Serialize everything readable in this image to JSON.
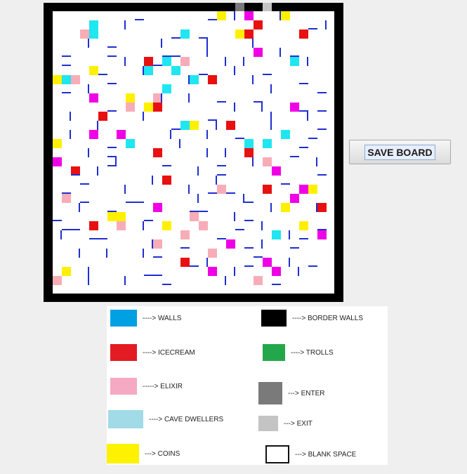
{
  "board": {
    "grid_size": 31,
    "colors": {
      "border": "#000000",
      "wall": "#1f2fd0",
      "icecream": "#e81010",
      "elixir": "#f7adb7",
      "cave_dwellers": "#1fe6f0",
      "coins": "#fff000",
      "magenta": "#f000e6",
      "enter": "#7a7a7a",
      "exit": "#c4c4c4"
    },
    "gates": [
      {
        "type": "enter",
        "col": 20
      },
      {
        "type": "exit",
        "col": 23
      }
    ],
    "cells": [
      {
        "t": "coins",
        "c": 18,
        "r": 0
      },
      {
        "t": "magenta",
        "c": 21,
        "r": 0
      },
      {
        "t": "coins",
        "c": 25,
        "r": 0
      },
      {
        "t": "cave_dwellers",
        "c": 4,
        "r": 1
      },
      {
        "t": "icecream",
        "c": 22,
        "r": 1
      },
      {
        "t": "elixir",
        "c": 3,
        "r": 2
      },
      {
        "t": "cave_dwellers",
        "c": 4,
        "r": 2
      },
      {
        "t": "cave_dwellers",
        "c": 14,
        "r": 2
      },
      {
        "t": "coins",
        "c": 20,
        "r": 2
      },
      {
        "t": "icecream",
        "c": 21,
        "r": 2
      },
      {
        "t": "icecream",
        "c": 27,
        "r": 2
      },
      {
        "t": "magenta",
        "c": 22,
        "r": 4
      },
      {
        "t": "icecream",
        "c": 10,
        "r": 5
      },
      {
        "t": "cave_dwellers",
        "c": 12,
        "r": 5
      },
      {
        "t": "elixir",
        "c": 14,
        "r": 5
      },
      {
        "t": "cave_dwellers",
        "c": 26,
        "r": 5
      },
      {
        "t": "coins",
        "c": 4,
        "r": 6
      },
      {
        "t": "cave_dwellers",
        "c": 10,
        "r": 6
      },
      {
        "t": "cave_dwellers",
        "c": 13,
        "r": 6
      },
      {
        "t": "coins",
        "c": 0,
        "r": 7
      },
      {
        "t": "cave_dwellers",
        "c": 1,
        "r": 7
      },
      {
        "t": "elixir",
        "c": 2,
        "r": 7
      },
      {
        "t": "cave_dwellers",
        "c": 15,
        "r": 7
      },
      {
        "t": "icecream",
        "c": 17,
        "r": 7
      },
      {
        "t": "cave_dwellers",
        "c": 12,
        "r": 8
      },
      {
        "t": "magenta",
        "c": 4,
        "r": 9
      },
      {
        "t": "coins",
        "c": 8,
        "r": 9
      },
      {
        "t": "elixir",
        "c": 11,
        "r": 9
      },
      {
        "t": "elixir",
        "c": 8,
        "r": 10
      },
      {
        "t": "coins",
        "c": 10,
        "r": 10
      },
      {
        "t": "icecream",
        "c": 11,
        "r": 10
      },
      {
        "t": "magenta",
        "c": 26,
        "r": 10
      },
      {
        "t": "icecream",
        "c": 5,
        "r": 11
      },
      {
        "t": "cave_dwellers",
        "c": 14,
        "r": 12
      },
      {
        "t": "coins",
        "c": 15,
        "r": 12
      },
      {
        "t": "icecream",
        "c": 19,
        "r": 12
      },
      {
        "t": "magenta",
        "c": 4,
        "r": 13
      },
      {
        "t": "magenta",
        "c": 7,
        "r": 13
      },
      {
        "t": "cave_dwellers",
        "c": 25,
        "r": 13
      },
      {
        "t": "coins",
        "c": 0,
        "r": 14
      },
      {
        "t": "cave_dwellers",
        "c": 8,
        "r": 14
      },
      {
        "t": "cave_dwellers",
        "c": 21,
        "r": 14
      },
      {
        "t": "cave_dwellers",
        "c": 23,
        "r": 14
      },
      {
        "t": "icecream",
        "c": 11,
        "r": 15
      },
      {
        "t": "icecream",
        "c": 21,
        "r": 15
      },
      {
        "t": "magenta",
        "c": 0,
        "r": 16
      },
      {
        "t": "elixir",
        "c": 23,
        "r": 16
      },
      {
        "t": "icecream",
        "c": 2,
        "r": 17
      },
      {
        "t": "magenta",
        "c": 24,
        "r": 17
      },
      {
        "t": "icecream",
        "c": 12,
        "r": 18
      },
      {
        "t": "elixir",
        "c": 18,
        "r": 19
      },
      {
        "t": "icecream",
        "c": 23,
        "r": 19
      },
      {
        "t": "magenta",
        "c": 27,
        "r": 19
      },
      {
        "t": "coins",
        "c": 28,
        "r": 19
      },
      {
        "t": "elixir",
        "c": 1,
        "r": 20
      },
      {
        "t": "magenta",
        "c": 26,
        "r": 20
      },
      {
        "t": "magenta",
        "c": 11,
        "r": 21
      },
      {
        "t": "coins",
        "c": 25,
        "r": 21
      },
      {
        "t": "icecream",
        "c": 29,
        "r": 21
      },
      {
        "t": "coins",
        "c": 6,
        "r": 22
      },
      {
        "t": "coins",
        "c": 7,
        "r": 22
      },
      {
        "t": "elixir",
        "c": 15,
        "r": 22
      },
      {
        "t": "icecream",
        "c": 4,
        "r": 23
      },
      {
        "t": "elixir",
        "c": 7,
        "r": 23
      },
      {
        "t": "coins",
        "c": 12,
        "r": 23
      },
      {
        "t": "elixir",
        "c": 16,
        "r": 23
      },
      {
        "t": "coins",
        "c": 27,
        "r": 23
      },
      {
        "t": "elixir",
        "c": 14,
        "r": 24
      },
      {
        "t": "cave_dwellers",
        "c": 24,
        "r": 24
      },
      {
        "t": "magenta",
        "c": 29,
        "r": 24
      },
      {
        "t": "elixir",
        "c": 11,
        "r": 25
      },
      {
        "t": "magenta",
        "c": 19,
        "r": 25
      },
      {
        "t": "elixir",
        "c": 17,
        "r": 26
      },
      {
        "t": "icecream",
        "c": 14,
        "r": 27
      },
      {
        "t": "magenta",
        "c": 23,
        "r": 27
      },
      {
        "t": "coins",
        "c": 1,
        "r": 28
      },
      {
        "t": "magenta",
        "c": 17,
        "r": 28
      },
      {
        "t": "magenta",
        "c": 24,
        "r": 28
      },
      {
        "t": "elixir",
        "c": 0,
        "r": 29
      },
      {
        "t": "elixir",
        "c": 22,
        "r": 29
      }
    ],
    "walls": [
      {
        "o": "h",
        "c": 9,
        "r": 0
      },
      {
        "o": "h",
        "c": 17,
        "r": 0
      },
      {
        "o": "v",
        "c": 19,
        "r": 0
      },
      {
        "o": "v",
        "c": 24,
        "r": 0
      },
      {
        "o": "v",
        "c": 7,
        "r": 1
      },
      {
        "o": "h",
        "c": 13,
        "r": 2
      },
      {
        "o": "h",
        "c": 16,
        "r": 2
      },
      {
        "o": "v",
        "c": 29,
        "r": 1
      },
      {
        "o": "h",
        "c": 28,
        "r": 1
      },
      {
        "o": "v",
        "c": 3,
        "r": 3
      },
      {
        "o": "h",
        "c": 6,
        "r": 3
      },
      {
        "o": "v",
        "c": 11,
        "r": 3
      },
      {
        "o": "v",
        "c": 16,
        "r": 3
      },
      {
        "o": "v",
        "c": 21,
        "r": 3
      },
      {
        "o": "h",
        "c": 1,
        "r": 4
      },
      {
        "o": "h",
        "c": 6,
        "r": 4
      },
      {
        "o": "h",
        "c": 12,
        "r": 4
      },
      {
        "o": "h",
        "c": 13,
        "r": 4
      },
      {
        "o": "v",
        "c": 16,
        "r": 4
      },
      {
        "o": "v",
        "c": 24,
        "r": 4
      },
      {
        "o": "h",
        "c": 26,
        "r": 4
      },
      {
        "o": "h",
        "c": 1,
        "r": 5
      },
      {
        "o": "v",
        "c": 7,
        "r": 5
      },
      {
        "o": "h",
        "c": 11,
        "r": 5
      },
      {
        "o": "v",
        "c": 18,
        "r": 5
      },
      {
        "o": "v",
        "c": 20,
        "r": 5
      },
      {
        "o": "v",
        "c": 27,
        "r": 5
      },
      {
        "o": "h",
        "c": 5,
        "r": 6
      },
      {
        "o": "v",
        "c": 9,
        "r": 6
      },
      {
        "o": "h",
        "c": 16,
        "r": 6
      },
      {
        "o": "v",
        "c": 19,
        "r": 6
      },
      {
        "o": "h",
        "c": 23,
        "r": 6
      },
      {
        "o": "h",
        "c": 6,
        "r": 7
      },
      {
        "o": "v",
        "c": 14,
        "r": 7
      },
      {
        "o": "v",
        "c": 21,
        "r": 7
      },
      {
        "o": "h",
        "c": 27,
        "r": 7
      },
      {
        "o": "h",
        "c": 1,
        "r": 8
      },
      {
        "o": "v",
        "c": 3,
        "r": 8
      },
      {
        "o": "v",
        "c": 23,
        "r": 8
      },
      {
        "o": "h",
        "c": 29,
        "r": 8
      },
      {
        "o": "v",
        "c": 11,
        "r": 9
      },
      {
        "o": "v",
        "c": 14,
        "r": 9
      },
      {
        "o": "h",
        "c": 18,
        "r": 9
      },
      {
        "o": "h",
        "c": 22,
        "r": 9
      },
      {
        "o": "h",
        "c": 6,
        "r": 10
      },
      {
        "o": "v",
        "c": 19,
        "r": 10
      },
      {
        "o": "v",
        "c": 22,
        "r": 10
      },
      {
        "o": "h",
        "c": 27,
        "r": 10
      },
      {
        "o": "h",
        "c": 29,
        "r": 10
      },
      {
        "o": "v",
        "c": 1,
        "r": 11
      },
      {
        "o": "v",
        "c": 9,
        "r": 11
      },
      {
        "o": "h",
        "c": 17,
        "r": 11
      },
      {
        "o": "v",
        "c": 23,
        "r": 11
      },
      {
        "o": "v",
        "c": 27,
        "r": 11
      },
      {
        "o": "v",
        "c": 4,
        "r": 12
      },
      {
        "o": "h",
        "c": 13,
        "r": 12
      },
      {
        "o": "v",
        "c": 17,
        "r": 12
      },
      {
        "o": "v",
        "c": 23,
        "r": 12
      },
      {
        "o": "h",
        "c": 29,
        "r": 12
      },
      {
        "o": "h",
        "c": 20,
        "r": 13
      },
      {
        "o": "v",
        "c": 1,
        "r": 13
      },
      {
        "o": "v",
        "c": 12,
        "r": 13
      },
      {
        "o": "v",
        "c": 16,
        "r": 13
      },
      {
        "o": "h",
        "c": 28,
        "r": 13
      },
      {
        "o": "h",
        "c": 6,
        "r": 14
      },
      {
        "o": "v",
        "c": 13,
        "r": 14
      },
      {
        "o": "h",
        "c": 27,
        "r": 14
      },
      {
        "o": "v",
        "c": 3,
        "r": 15
      },
      {
        "o": "h",
        "c": 6,
        "r": 15
      },
      {
        "o": "v",
        "c": 16,
        "r": 15
      },
      {
        "o": "v",
        "c": 18,
        "r": 15
      },
      {
        "o": "h",
        "c": 26,
        "r": 15
      },
      {
        "o": "v",
        "c": 6,
        "r": 16
      },
      {
        "o": "h",
        "c": 6,
        "r": 16
      },
      {
        "o": "h",
        "c": 12,
        "r": 16
      },
      {
        "o": "h",
        "c": 18,
        "r": 16
      },
      {
        "o": "v",
        "c": 21,
        "r": 16
      },
      {
        "o": "v",
        "c": 28,
        "r": 16
      },
      {
        "o": "h",
        "c": 2,
        "r": 17
      },
      {
        "o": "v",
        "c": 4,
        "r": 17
      },
      {
        "o": "v",
        "c": 15,
        "r": 17
      },
      {
        "o": "h",
        "c": 18,
        "r": 17
      },
      {
        "o": "h",
        "c": 29,
        "r": 17
      },
      {
        "o": "h",
        "c": 3,
        "r": 18
      },
      {
        "o": "v",
        "c": 10,
        "r": 18
      },
      {
        "o": "v",
        "c": 17,
        "r": 18
      },
      {
        "o": "h",
        "c": 25,
        "r": 18
      },
      {
        "o": "h",
        "c": 1,
        "r": 19
      },
      {
        "o": "v",
        "c": 7,
        "r": 19
      },
      {
        "o": "v",
        "c": 14,
        "r": 19
      },
      {
        "o": "h",
        "c": 17,
        "r": 19
      },
      {
        "o": "h",
        "c": 19,
        "r": 19
      },
      {
        "o": "h",
        "c": 3,
        "r": 20
      },
      {
        "o": "h",
        "c": 8,
        "r": 20
      },
      {
        "o": "h",
        "c": 9,
        "r": 20
      },
      {
        "o": "v",
        "c": 15,
        "r": 20
      },
      {
        "o": "v",
        "c": 20,
        "r": 20
      },
      {
        "o": "h",
        "c": 21,
        "r": 20
      },
      {
        "o": "v",
        "c": 2,
        "r": 21
      },
      {
        "o": "h",
        "c": 6,
        "r": 21
      },
      {
        "o": "h",
        "c": 15,
        "r": 21
      },
      {
        "o": "h",
        "c": 16,
        "r": 21
      },
      {
        "o": "v",
        "c": 23,
        "r": 21
      },
      {
        "o": "v",
        "c": 28,
        "r": 21
      },
      {
        "o": "h",
        "c": 0,
        "r": 22
      },
      {
        "o": "h",
        "c": 10,
        "r": 22
      },
      {
        "o": "v",
        "c": 19,
        "r": 22
      },
      {
        "o": "h",
        "c": 21,
        "r": 22
      },
      {
        "o": "h",
        "c": 1,
        "r": 23
      },
      {
        "o": "h",
        "c": 2,
        "r": 23
      },
      {
        "o": "v",
        "c": 9,
        "r": 23
      },
      {
        "o": "h",
        "c": 20,
        "r": 23
      },
      {
        "o": "v",
        "c": 22,
        "r": 23
      },
      {
        "o": "h",
        "c": 29,
        "r": 23
      },
      {
        "o": "v",
        "c": 0,
        "r": 24
      },
      {
        "o": "h",
        "c": 4,
        "r": 24
      },
      {
        "o": "h",
        "c": 5,
        "r": 24
      },
      {
        "o": "h",
        "c": 18,
        "r": 24
      },
      {
        "o": "v",
        "c": 25,
        "r": 24
      },
      {
        "o": "h",
        "c": 27,
        "r": 24
      },
      {
        "o": "v",
        "c": 10,
        "r": 25
      },
      {
        "o": "h",
        "c": 14,
        "r": 25
      },
      {
        "o": "h",
        "c": 21,
        "r": 25
      },
      {
        "o": "v",
        "c": 22,
        "r": 25
      },
      {
        "o": "h",
        "c": 26,
        "r": 25
      },
      {
        "o": "v",
        "c": 2,
        "r": 26
      },
      {
        "o": "v",
        "c": 5,
        "r": 26
      },
      {
        "o": "v",
        "c": 9,
        "r": 26
      },
      {
        "o": "h",
        "c": 11,
        "r": 26
      },
      {
        "o": "h",
        "c": 22,
        "r": 26
      },
      {
        "o": "h",
        "c": 15,
        "r": 27
      },
      {
        "o": "v",
        "c": 16,
        "r": 27
      },
      {
        "o": "h",
        "c": 21,
        "r": 27
      },
      {
        "o": "v",
        "c": 25,
        "r": 27
      },
      {
        "o": "h",
        "c": 28,
        "r": 27
      },
      {
        "o": "v",
        "c": 3,
        "r": 28
      },
      {
        "o": "h",
        "c": 10,
        "r": 28
      },
      {
        "o": "h",
        "c": 11,
        "r": 28
      },
      {
        "o": "v",
        "c": 19,
        "r": 28
      },
      {
        "o": "v",
        "c": 26,
        "r": 28
      },
      {
        "o": "v",
        "c": 7,
        "r": 29
      },
      {
        "o": "h",
        "c": 12,
        "r": 29
      },
      {
        "o": "v",
        "c": 18,
        "r": 29
      },
      {
        "o": "v",
        "c": 3,
        "r": 29
      },
      {
        "o": "h",
        "c": 24,
        "r": 29
      }
    ]
  },
  "save_button": {
    "label": "SAVE BOARD"
  },
  "legend": {
    "items": [
      {
        "key": "walls",
        "label": "----> WALLS",
        "color": "#00a0e3",
        "border": "none"
      },
      {
        "key": "border_walls",
        "label": "----> BORDER WALLS",
        "color": "#000000",
        "border": "none"
      },
      {
        "key": "icecream",
        "label": "----> ICECREAM",
        "color": "#e31c23",
        "border": "none"
      },
      {
        "key": "trolls",
        "label": "----> TROLLS",
        "color": "#22a84a",
        "border": "none"
      },
      {
        "key": "elixir",
        "label": "-----> ELIXIR",
        "color": "#f6a9c2",
        "border": "none"
      },
      {
        "key": "enter",
        "label": "---> ENTER",
        "color": "#7a7a7a",
        "border": "none"
      },
      {
        "key": "cave_dwellers",
        "label": "----> CAVE DWELLERS",
        "color": "#a1dbe8",
        "border": "none"
      },
      {
        "key": "exit",
        "label": "---> EXIT",
        "color": "#c4c4c4",
        "border": "none"
      },
      {
        "key": "coins",
        "label": "---> COINS",
        "color": "#fff200",
        "border": "none"
      },
      {
        "key": "blank_space",
        "label": "---> BLANK SPACE",
        "color": "#ffffff",
        "border": "#111111"
      }
    ]
  }
}
